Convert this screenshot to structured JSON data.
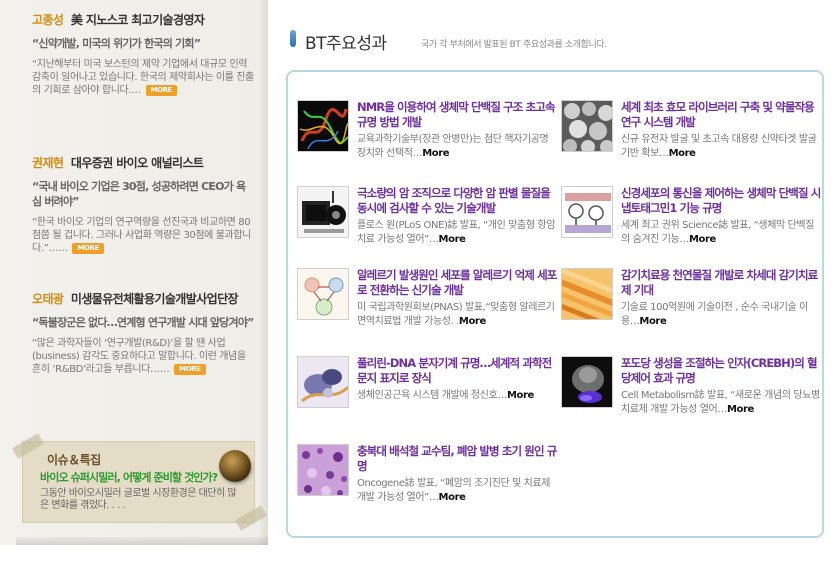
{
  "experts": [
    {
      "name": "고종성",
      "role": "美 지노스코 최고기술경영자",
      "quote": "“신약개발, 미국의 위기가 한국의 기회”",
      "body": "“지난해부터 미국 보스턴의 제약 기업에서 대규모 인력 감축이 일어나고 있습니다. 한국의 제약회사는 이를 진출의 기회로 삼아야 합니다.…",
      "more": "MORE"
    },
    {
      "name": "권재현",
      "role": "대우증권 바이오 애널리스트",
      "quote": "“국내 바이오 기업은 30점, 성공하려면 CEO가 욕심 버려야”",
      "body": "“한국 바이오 기업의 연구역량을 선진국과 비교하면 80점쯤 될 겁니다. 그러나 사업화 역량은 30점에 불과합니다.”……",
      "more": "MORE"
    },
    {
      "name": "오태광",
      "role": "미생물유전체활용기술개발사업단장",
      "quote": "“독불장군은 없다…연계형 연구개발 시대 앞당겨야”",
      "body": "“많은 과학자들이 ‘연구개발(R&D)’을 할 땐 사업(business) 감각도 중요하다고 말합니다. 이런 개념을 흔히 ‘R&BD’라고들 부릅니다……",
      "more": "MORE"
    }
  ],
  "issue": {
    "title": "이슈＆특집",
    "headline": "바이오 슈퍼시밀러, 어떻게 준비할 것인가?",
    "body": "그동안 바이오시밀러 글로벌 시장환경은 대단히 많은 변화를 겪었다. . . ."
  },
  "section": {
    "title": "BT주요성과",
    "subtitle": "국가 각 부처에서 발표된 BT 주요성과를 소개합니다."
  },
  "items": [
    {
      "title": "NMR을 이용하여 생체막 단백질 구조 초고속 규명 방법 개발",
      "desc": "교육과학기술부(장관 안병만)는 첨단 핵자기공명장치와 선택적…",
      "more": "More",
      "icon": "protein-structure-image"
    },
    {
      "title": "세계 최초 효모 라이브러리 구축 및 약물작용 연구 시스템 개발",
      "desc": "신규 유전자 발굴 및 초고속 대용량 신약타겟 발굴 기반 확보…",
      "more": "More",
      "icon": "yeast-cells-image"
    },
    {
      "title": "극소량의 암 조직으로 다양한 암 판별 물질을 동시에 검사할 수 있는 기술개발",
      "desc": "플로스 원(PLoS ONE)誌 발표, “개인 맞춤형 항암치료 가능성 열어”…",
      "more": "More",
      "icon": "cancer-detection-device-image"
    },
    {
      "title": "신경세포의 통신을 제어하는 생체막 단백질 시냅토태그민1 기능 규명",
      "desc": "세계 최고 권위 Science誌 발표, “생체막 단백질의 숨겨진 기능…",
      "more": "More",
      "icon": "synapse-diagram-image"
    },
    {
      "title": "알레르기 발생원인 세포를 알레르기 억제 세포로 전환하는 신기술 개발",
      "desc": "미 국립과학원회보(PNAS) 발표,“맞춤형 알레르기 면역치료법 개발 가능성. .",
      "more": "More",
      "icon": "allergy-cell-diagram-image"
    },
    {
      "title": "감기치료용 천연물질 개발로 차세대 감기치료제 기대",
      "desc": "기술료 100억원에 기술이전 , 순수 국내기술 이용…",
      "more": "More",
      "icon": "virus-surface-image"
    },
    {
      "title": "풀리린-DNA 분자기계 규명…세계적 과학전문지 표지로 장식",
      "desc": "생체인공근육 시스템 개발에 청신호…",
      "more": "More",
      "icon": "molecular-machine-image"
    },
    {
      "title": "포도당 생성을 조절하는 인자(CREBH)의 혈당제어 효과 규명",
      "desc": "Cell Metabolism誌 발표, “새로운 개념의 당뇨병 치료제 개발 가능성 열어…",
      "more": "More",
      "icon": "liver-scan-image"
    },
    {
      "title": "충북대 배석철 교수팀, 폐암 발병 초기 원인 규명",
      "desc": "Oncogene誌 발표, “폐암의 조기진단 및 치료제 개발 가능성 열어”…",
      "more": "More",
      "icon": "lung-tissue-image"
    }
  ],
  "colors": {
    "accent_name": "#d58a10",
    "item_title": "#6d2fa0",
    "panel_border": "#b9d8e4",
    "more_button": "#f0a02a",
    "issue_headline": "#2e9a2e"
  }
}
